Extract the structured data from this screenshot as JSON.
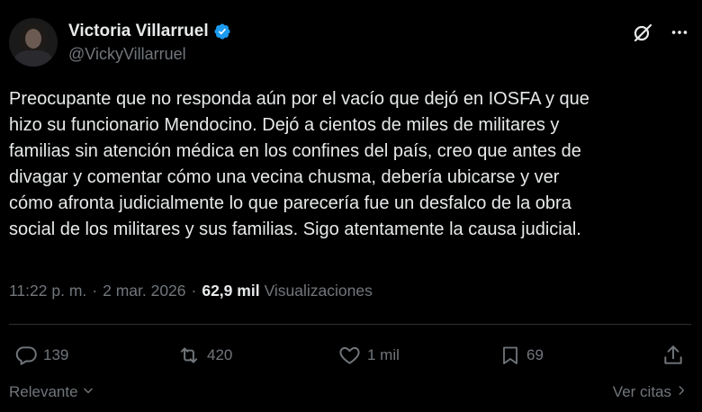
{
  "tweet": {
    "display_name": "Victoria Villarruel",
    "handle": "@VickyVillarruel",
    "text": "Preocupante que no responda aún por el vacío que dejó en IOSFA y que\nhizo su funcionario Mendocino. Dejó a cientos de miles de militares y\nfamilias sin atención médica en los confines del país, creo que antes de\ndivagar y comentar cómo una  vecina chusma, debería ubicarse y ver\ncómo afronta judicialmente lo que parecería fue un desfalco de la obra\nsocial de los militares y sus familias. Sigo atentamente la causa judicial.",
    "time": "11:22 p. m.",
    "separator": "·",
    "date": "2 mar. 2026",
    "views_count": "62,9 mil",
    "views_label": "Visualizaciones"
  },
  "stats": {
    "replies": "139",
    "reposts": "420",
    "likes": "1 mil",
    "bookmarks": "69"
  },
  "footer": {
    "sort_label": "Relevante",
    "quotes_label": "Ver citas"
  },
  "icons": {
    "verified": "verified-badge-icon",
    "grok": "grok-icon",
    "more": "more-icon",
    "reply": "reply-icon",
    "repost": "repost-icon",
    "like": "heart-icon",
    "bookmark": "bookmark-icon",
    "share": "share-icon"
  },
  "colors": {
    "background": "#000000",
    "text": "#e7e9ea",
    "muted": "#71767b",
    "verified": "#1d9bf0"
  }
}
